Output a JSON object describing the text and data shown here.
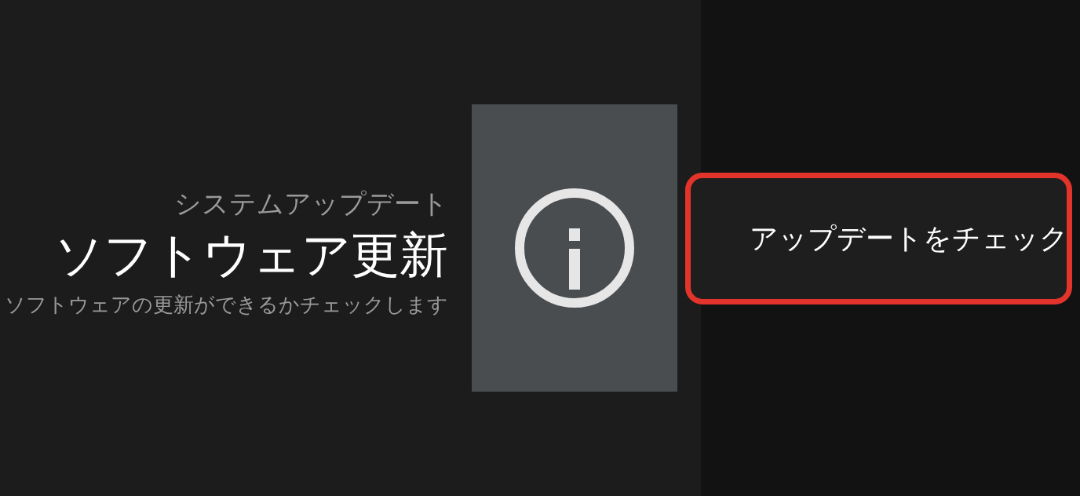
{
  "header": {
    "category": "システムアップデート",
    "title": "ソフトウェア更新",
    "description": "ソフトウェアの更新ができるかチェックします"
  },
  "actions": [
    {
      "label": "アップデートをチェック",
      "selected": true
    }
  ]
}
